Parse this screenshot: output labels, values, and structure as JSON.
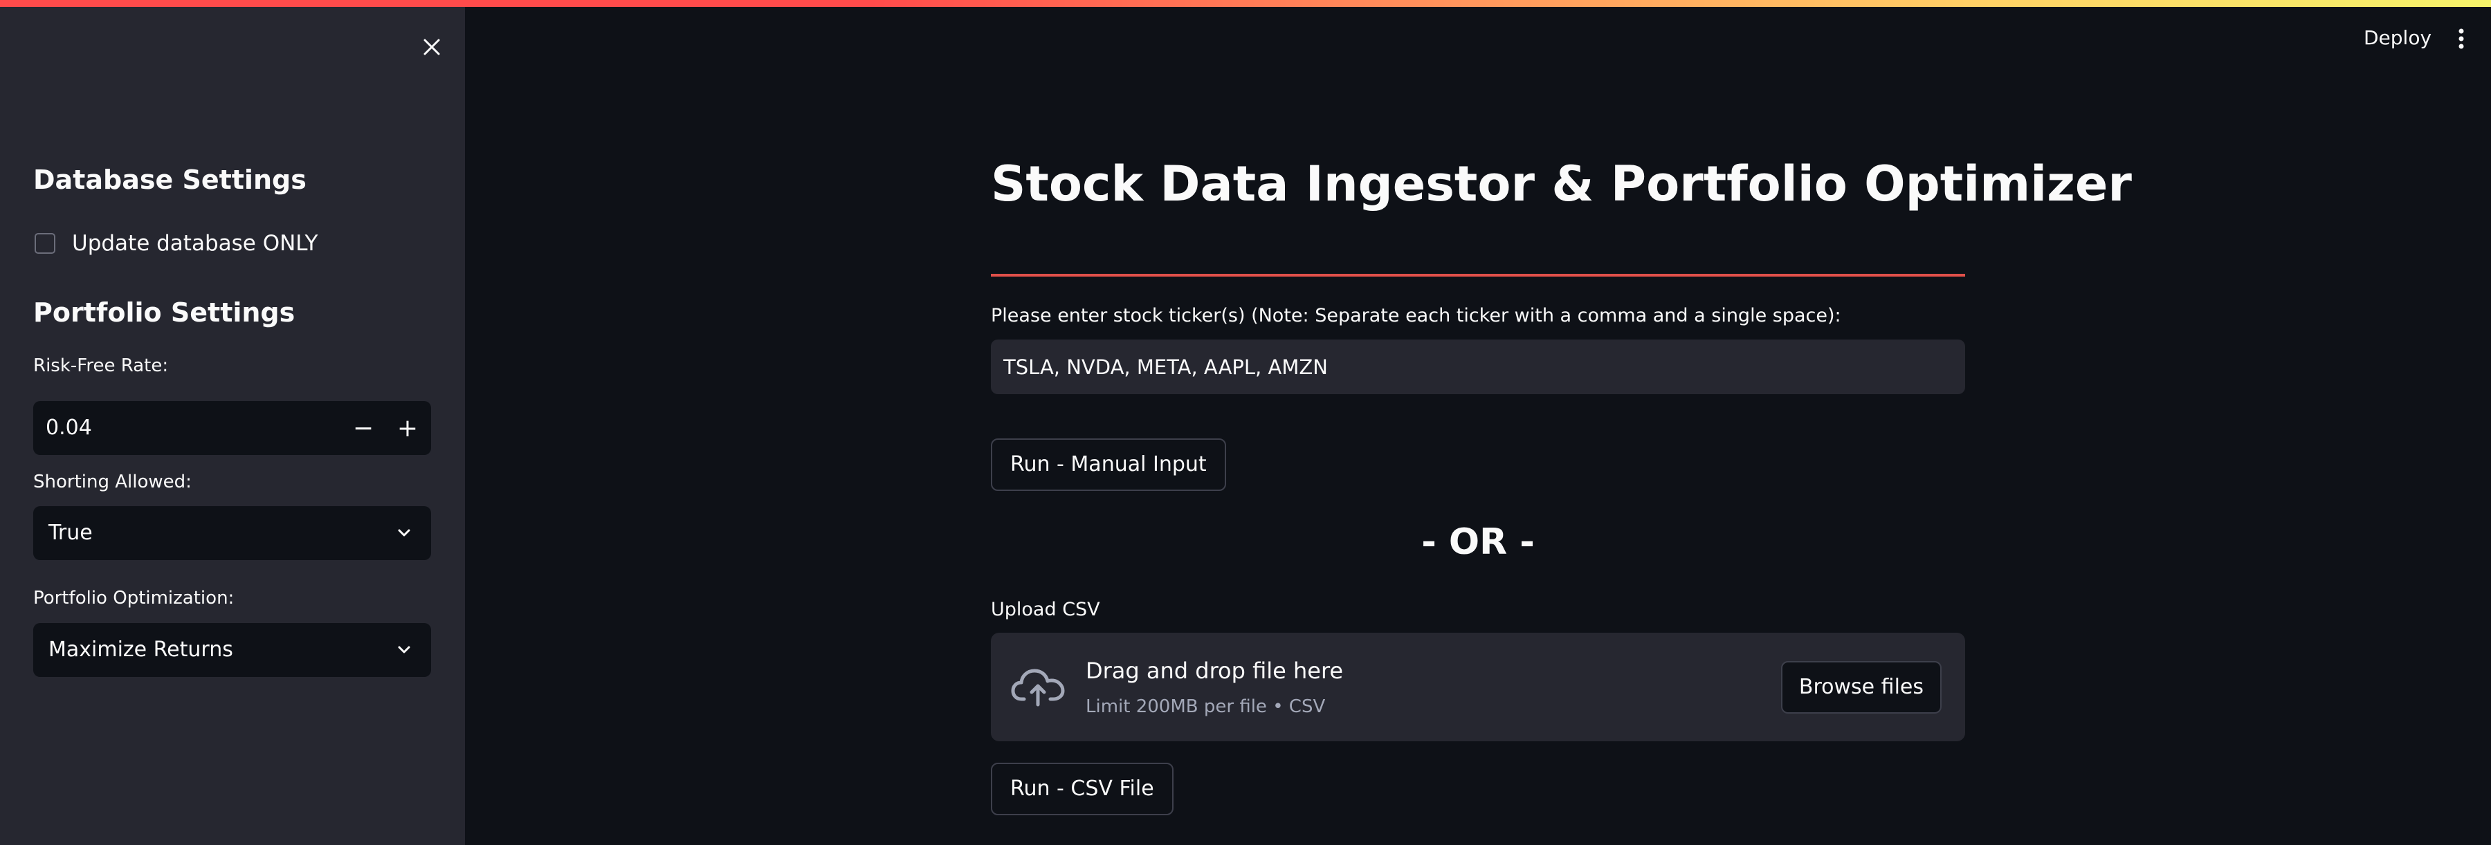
{
  "header": {
    "deploy_label": "Deploy",
    "menu_icon": "kebab-menu-icon"
  },
  "sidebar": {
    "close_icon": "close-icon",
    "database_section_title": "Database Settings",
    "update_db_checkbox": {
      "label": "Update database ONLY",
      "checked": false
    },
    "portfolio_section_title": "Portfolio Settings",
    "risk_free_rate": {
      "label": "Risk-Free Rate:",
      "value": "0.04",
      "decrement": "−",
      "increment": "+"
    },
    "shorting_allowed": {
      "label": "Shorting Allowed:",
      "value": "True"
    },
    "portfolio_optimization": {
      "label": "Portfolio Optimization:",
      "value": "Maximize Returns"
    }
  },
  "main": {
    "title": "Stock Data Ingestor & Portfolio Optimizer",
    "ticker_prompt": "Please enter stock ticker(s) (Note: Separate each ticker with a comma and a single space):",
    "ticker_value": "TSLA, NVDA, META, AAPL, AMZN",
    "run_manual_label": "Run - Manual Input",
    "or_text": "- OR -",
    "upload_label": "Upload CSV",
    "dropzone": {
      "title": "Drag and drop file here",
      "subtitle": "Limit 200MB per file • CSV",
      "browse_label": "Browse files",
      "icon": "cloud-upload-icon"
    },
    "run_csv_label": "Run - CSV File"
  },
  "colors": {
    "background": "#0e1117",
    "sidebar": "#262730",
    "accent": "#ff4b4b",
    "text": "#fafafa",
    "muted_text": "#a3a8b8"
  }
}
